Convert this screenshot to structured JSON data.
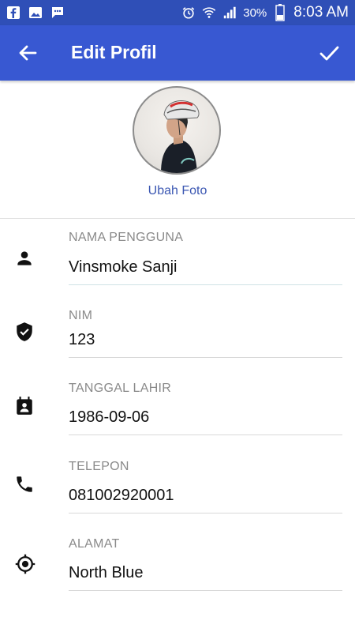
{
  "statusbar": {
    "battery": "30%",
    "time": "8:03 AM"
  },
  "appbar": {
    "title": "Edit Profil"
  },
  "photo": {
    "change_label": "Ubah Foto"
  },
  "fields": [
    {
      "label": "NAMA PENGGUNA",
      "value": "Vinsmoke Sanji",
      "icon": "person-icon"
    },
    {
      "label": "NIM",
      "value": "123",
      "icon": "verified-shield-icon"
    },
    {
      "label": "TANGGAL LAHIR",
      "value": "1986-09-06",
      "icon": "calendar-contact-icon"
    },
    {
      "label": "TELEPON",
      "value": "081002920001",
      "icon": "phone-icon"
    },
    {
      "label": "ALAMAT",
      "value": "North Blue",
      "icon": "location-target-icon"
    }
  ]
}
